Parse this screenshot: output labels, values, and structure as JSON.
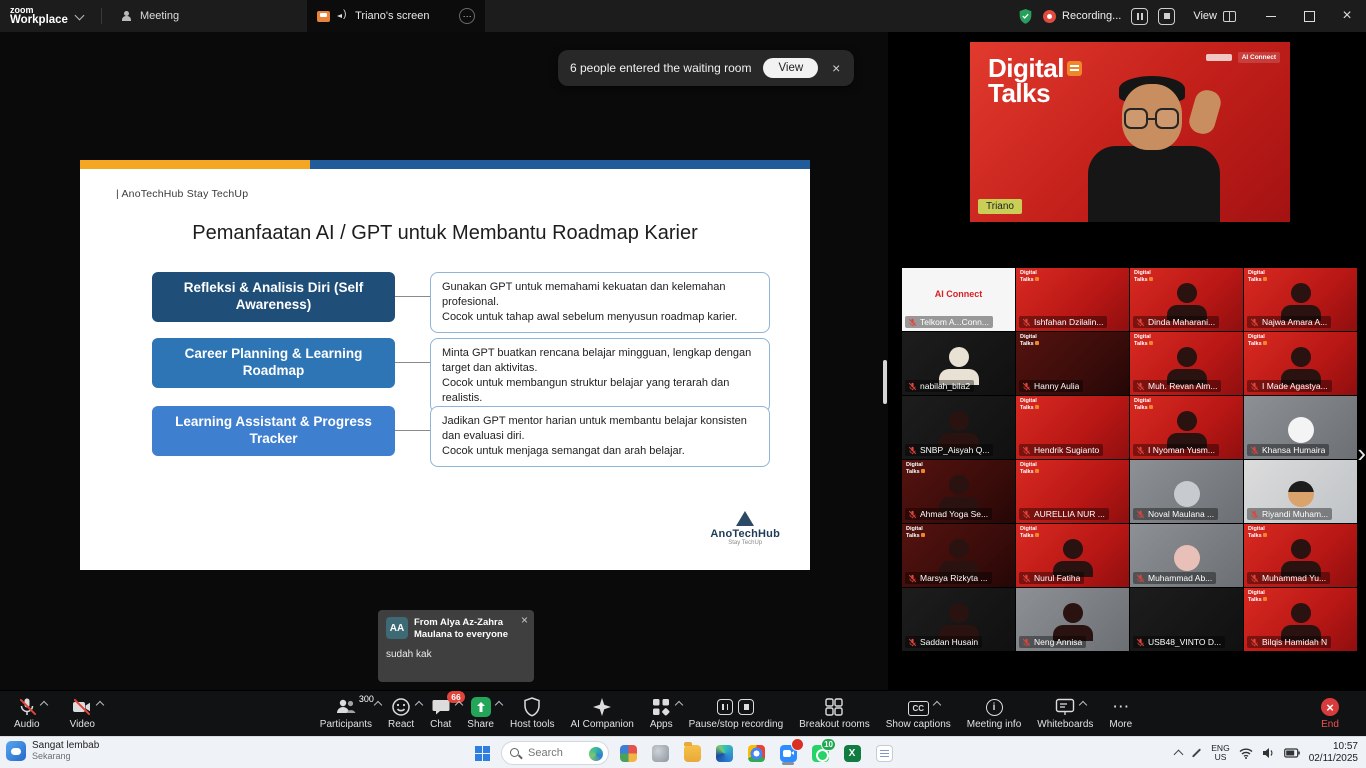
{
  "titlebar": {
    "logo_top": "zoom",
    "logo_bottom": "Workplace",
    "meeting_tab": "Meeting",
    "screen_tab": "Triano's screen",
    "recording_label": "Recording...",
    "view_label": "View"
  },
  "notification": {
    "text": "6 people entered the waiting room",
    "view_button": "View",
    "close": "×"
  },
  "slide": {
    "header": "| AnoTechHub Stay TechUp",
    "title": "Pemanfaatan AI / GPT untuk Membantu Roadmap Karier",
    "rows": [
      {
        "label": "Refleksi & Analisis Diri (Self Awareness)",
        "desc": "Gunakan GPT untuk memahami kekuatan dan kelemahan profesional.\nCocok untuk tahap awal sebelum menyusun roadmap karier."
      },
      {
        "label": "Career Planning & Learning Roadmap",
        "desc": "Minta GPT buatkan rencana belajar mingguan, lengkap dengan target dan aktivitas.\nCocok untuk membangun struktur belajar yang terarah dan realistis."
      },
      {
        "label": "Learning Assistant & Progress Tracker",
        "desc": "Jadikan GPT mentor harian untuk membantu belajar konsisten dan evaluasi diri.\nCocok untuk menjaga semangat dan arah belajar."
      }
    ],
    "logo_name": "AnoTechHub",
    "logo_tagline": "Stay TechUp"
  },
  "chat_popup": {
    "avatar_initials": "AA",
    "from_text": "From Alya Az-Zahra Maulana to everyone",
    "message": "sudah kak",
    "close": "×"
  },
  "speaker_video": {
    "brand_line1": "Digital",
    "brand_line2": "Talks",
    "corner_logo": "AI Connect",
    "name": "Triano"
  },
  "tile_brand": {
    "line1": "Digital",
    "line2": "Talks"
  },
  "participants_grid": [
    {
      "name": "Telkom A...Conn...",
      "cls": "bg-white",
      "logo_text": "AI Connect"
    },
    {
      "name": "Ishfahan Dzilalin...",
      "cls": "bg-red"
    },
    {
      "name": "Dinda Maharani...",
      "cls": "bg-red fig-person"
    },
    {
      "name": "Najwa Amara A...",
      "cls": "bg-red fig-person"
    },
    {
      "name": "nabilah_bila2",
      "cls": "bg-dark fig-person-light"
    },
    {
      "name": "Hanny Aulia",
      "cls": "bg-darkred"
    },
    {
      "name": "Muh. Revan Alm...",
      "cls": "bg-red fig-person"
    },
    {
      "name": "I Made Agastya...",
      "cls": "bg-red fig-person"
    },
    {
      "name": "SNBP_Aisyah Q...",
      "cls": "bg-dark fig-person"
    },
    {
      "name": "Hendrik Sugianto",
      "cls": "bg-red"
    },
    {
      "name": "I Nyoman Yusm...",
      "cls": "bg-red fig-person"
    },
    {
      "name": "Khansa Humaira",
      "cls": "bg-grey fig-avatar-white"
    },
    {
      "name": "Ahmad Yoga Se...",
      "cls": "bg-darkred fig-person"
    },
    {
      "name": "AURELLIA NUR ...",
      "cls": "bg-red"
    },
    {
      "name": "Noval Maulana ...",
      "cls": "bg-grey fig-avatar-grey"
    },
    {
      "name": "Riyandi Muham...",
      "cls": "bg-lightgrey fig-avatar-human"
    },
    {
      "name": "Marsya Rizkyta ...",
      "cls": "bg-darkred fig-person"
    },
    {
      "name": "Nurul Fatiha",
      "cls": "bg-red fig-person"
    },
    {
      "name": "Muhammad Ab...",
      "cls": "bg-grey fig-avatar-cat"
    },
    {
      "name": "Muhammad Yu...",
      "cls": "bg-red fig-person"
    },
    {
      "name": "Saddan Husain",
      "cls": "bg-dark fig-person"
    },
    {
      "name": "Neng Annisa",
      "cls": "bg-grey fig-person"
    },
    {
      "name": "USB48_VINTO D...",
      "cls": "bg-dark"
    },
    {
      "name": "Bilqis Hamidah N",
      "cls": "bg-red fig-person"
    }
  ],
  "toolbar": {
    "audio": {
      "label": "Audio"
    },
    "video": {
      "label": "Video"
    },
    "participants": {
      "label": "Participants",
      "count": "300"
    },
    "react": {
      "label": "React"
    },
    "chat": {
      "label": "Chat",
      "badge": "66"
    },
    "share": {
      "label": "Share"
    },
    "host_tools": {
      "label": "Host tools"
    },
    "ai_companion": {
      "label": "AI Companion"
    },
    "apps": {
      "label": "Apps"
    },
    "record": {
      "label": "Pause/stop recording"
    },
    "breakout": {
      "label": "Breakout rooms"
    },
    "captions": {
      "label": "Show captions"
    },
    "info": {
      "label": "Meeting info"
    },
    "whiteboards": {
      "label": "Whiteboards"
    },
    "more": {
      "label": "More"
    },
    "end": {
      "label": "End"
    }
  },
  "taskbar": {
    "weather_line1": "Sangat lembab",
    "weather_line2": "Sekarang",
    "search_placeholder": "Search",
    "whatsapp_badge": "10",
    "tray": {
      "lang1": "ENG",
      "lang2": "US",
      "time": "10:57",
      "date": "02/11/2025"
    }
  }
}
